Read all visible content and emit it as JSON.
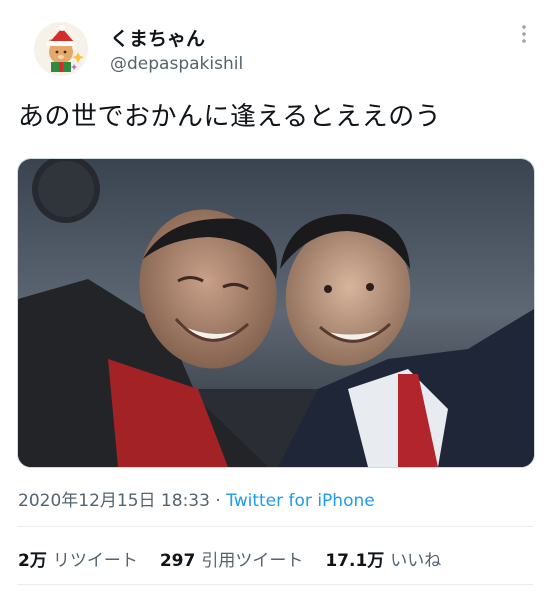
{
  "user": {
    "display_name": "くまちゃん",
    "handle": "@depaspakishil"
  },
  "tweet": {
    "text": "あの世でおかんに逢えるとええのう",
    "timestamp": "2020年12月15日 18:33",
    "separator": "·",
    "source": "Twitter for iPhone"
  },
  "stats": {
    "retweets_count": "2万",
    "retweets_label": "リツイート",
    "quotes_count": "297",
    "quotes_label": "引用ツイート",
    "likes_count": "17.1万",
    "likes_label": "いいね"
  },
  "colors": {
    "link": "#1d9bf0",
    "secondary_text": "#536471",
    "primary_text": "#0f1419"
  },
  "icons": {
    "more": "more-vertical-icon",
    "avatar": "bear-santa-avatar"
  }
}
